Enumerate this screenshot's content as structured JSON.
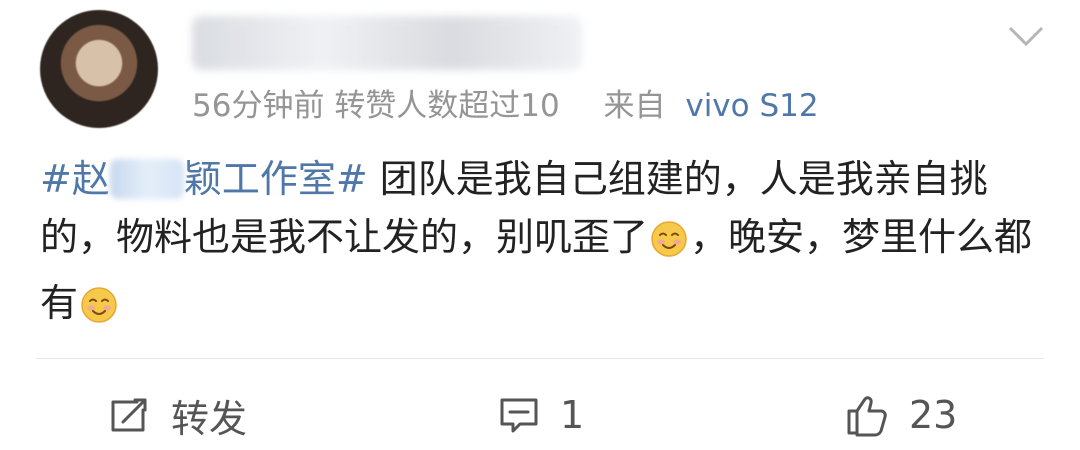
{
  "post": {
    "user": {
      "avatar_icon": "avatar",
      "name_blurred": true
    },
    "meta": {
      "time": "56分钟前",
      "repost_note": "转赞人数超过10",
      "source_prefix": "来自",
      "device": "vivo S12"
    },
    "content": {
      "hashtag_prefix": "#赵",
      "hashtag_suffix": "颖工作室#",
      "text_part1": "团队是我自己组建的，人是我亲自挑的，物料也是我不让发的，别叽歪了",
      "text_part2": "，晚安，梦里什么都有",
      "emoji_name": "smiling-emoji"
    },
    "actions": {
      "repost_label": "转发",
      "comment_count": "1",
      "like_count": "23"
    }
  }
}
